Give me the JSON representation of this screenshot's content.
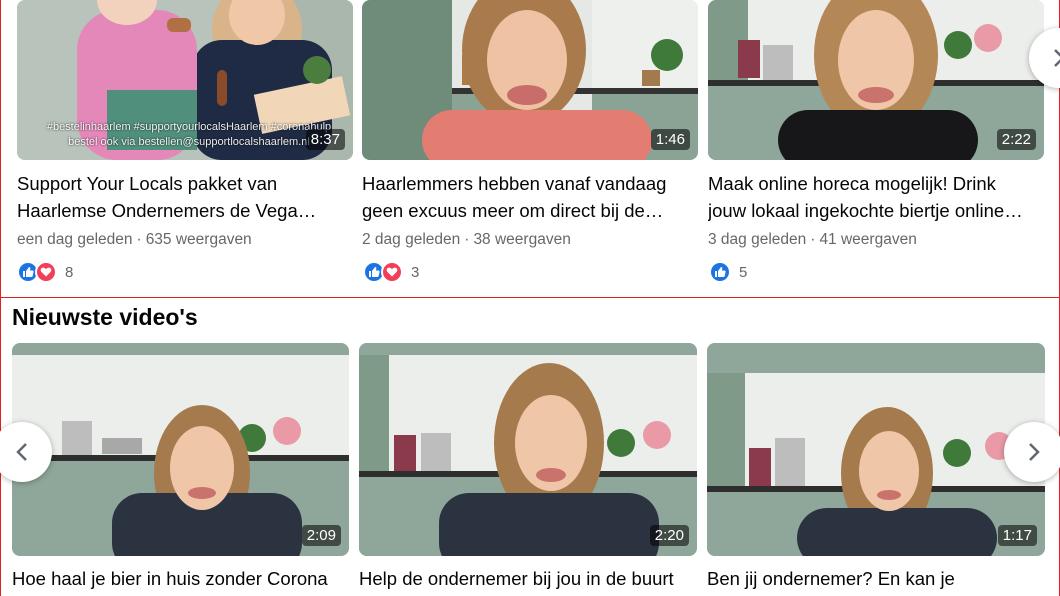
{
  "top_videos": [
    {
      "duration": "8:37",
      "overlay": "#bestelinhaarlem #supportyourlocalsHaarlem #coronahulp bestel ook via bestellen@supportlocalshaarlem.nl",
      "title_line1": "Support Your Locals pakket van",
      "title_line2": "Haarlemse Ondernemers de Vega…",
      "age": "een dag geleden",
      "views": "635 weergaven",
      "reactions": [
        "like",
        "love"
      ],
      "reaction_count": "8"
    },
    {
      "duration": "1:46",
      "title_line1": "Haarlemmers hebben vanaf vandaag",
      "title_line2": "geen excuus meer om direct bij de…",
      "age": "2 dag geleden",
      "views": "38 weergaven",
      "reactions": [
        "like",
        "love"
      ],
      "reaction_count": "3"
    },
    {
      "duration": "2:22",
      "title_line1": "Maak online horeca mogelijk! Drink",
      "title_line2": "jouw lokaal ingekochte biertje online…",
      "age": "3 dag geleden",
      "views": "41 weergaven",
      "reactions": [
        "like"
      ],
      "reaction_count": "5"
    }
  ],
  "newest_heading": "Nieuwste video's",
  "newest_videos": [
    {
      "duration": "2:09",
      "title_line1": "Hoe haal je bier in huis zonder Corona"
    },
    {
      "duration": "2:20",
      "title_line1": "Help de ondernemer bij jou in de buurt"
    },
    {
      "duration": "1:17",
      "title_line1": "Ben jij ondernemer? En kan je"
    }
  ],
  "colors": {
    "like": "#1b74e4",
    "love": "#f33e58",
    "section_border": "#e02020",
    "meta": "#65676b"
  }
}
